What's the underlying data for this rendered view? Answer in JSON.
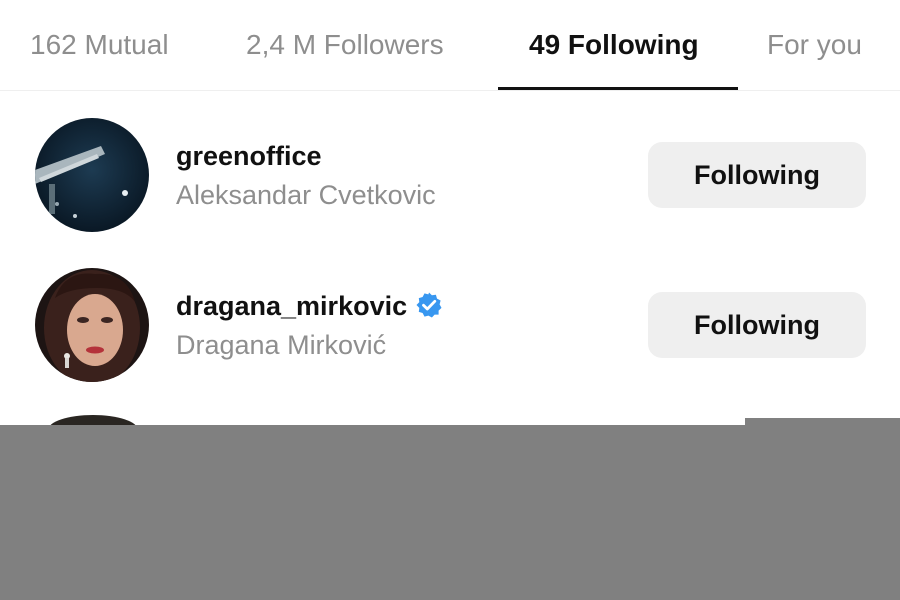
{
  "tabs": [
    {
      "label": "162 Mutual",
      "active": false
    },
    {
      "label": "2,4 M Followers",
      "active": false
    },
    {
      "label": "49 Following",
      "active": true
    },
    {
      "label": "For you",
      "active": false
    }
  ],
  "rows": [
    {
      "username": "greenoffice",
      "full_name": "Aleksandar Cvetkovic",
      "verified": false,
      "button_label": "Following"
    },
    {
      "username": "dragana_mirkovic",
      "full_name": "Dragana Mirković",
      "verified": true,
      "button_label": "Following"
    }
  ],
  "colors": {
    "primary_text": "#111111",
    "secondary_text": "#8e8e8e",
    "button_bg": "#efefef",
    "verified_badge": "#3897f0",
    "overlay": "#808080"
  },
  "icons": {
    "verified": "verified-badge-icon"
  }
}
